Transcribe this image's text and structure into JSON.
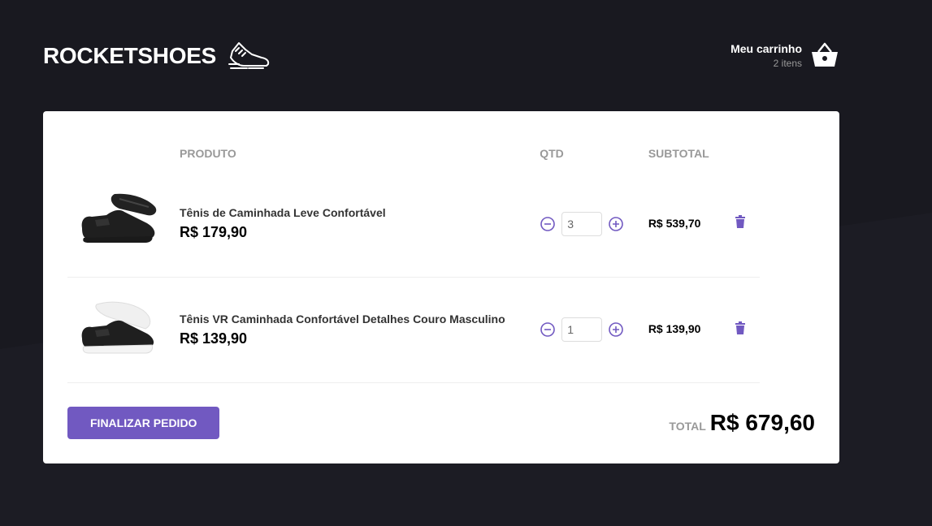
{
  "header": {
    "logo": "ROCKETSHOES",
    "logo_icon": "sneaker-icon",
    "cart_title": "Meu carrinho",
    "cart_count": "2 itens",
    "cart_icon": "basket-icon"
  },
  "table": {
    "columns": [
      "",
      "PRODUTO",
      "QTD",
      "SUBTOTAL",
      ""
    ],
    "rows": [
      {
        "title": "Tênis de Caminhada Leve Confortável",
        "price": "R$ 179,90",
        "qty": "3",
        "subtotal": "R$ 539,70",
        "sole_color": "#1a1a1a"
      },
      {
        "title": "Tênis VR Caminhada Confortável Detalhes Couro Masculino",
        "price": "R$ 139,90",
        "qty": "1",
        "subtotal": "R$ 139,90",
        "sole_color": "#f4f4f4"
      }
    ]
  },
  "footer": {
    "button_label": "Finalizar pedido",
    "total_label": "TOTAL",
    "total_value": "R$ 679,60"
  },
  "colors": {
    "background": "#191920",
    "accent": "#7159c1"
  }
}
